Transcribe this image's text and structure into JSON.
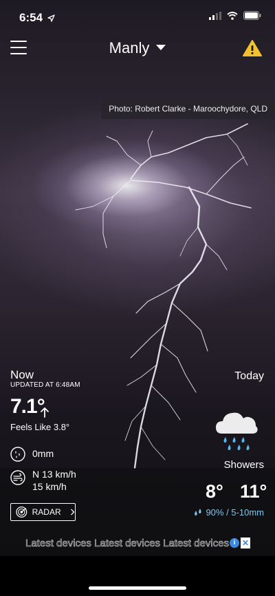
{
  "status_bar": {
    "time": "6:54"
  },
  "header": {
    "location": "Manly"
  },
  "photo_credit": "Photo: Robert Clarke - Maroochydore, QLD",
  "now": {
    "label": "Now",
    "updated": "UPDATED AT 6:48AM",
    "temperature": "7.1°",
    "feels_like": "Feels Like 3.8°",
    "rainfall": "0mm",
    "wind_direction_speed": "N 13 km/h",
    "wind_gust": "15 km/h"
  },
  "radar_button": {
    "label": "RADAR"
  },
  "today": {
    "label": "Today",
    "condition": "Showers",
    "min": "8°",
    "max": "11°",
    "rain_chance": "90% / 5-10mm"
  },
  "ad": {
    "text": "Latest devices Latest devices Latest devices"
  },
  "icons": [
    "menu-icon",
    "chevron-down-icon",
    "warning-icon",
    "arrow-up-icon",
    "rain-gauge-icon",
    "wind-icon",
    "radar-icon",
    "chevron-right-icon",
    "showers-icon",
    "raindrops-icon",
    "ad-info-icon",
    "close-icon"
  ],
  "colors": {
    "warning": "#f2c12e",
    "rain_accent": "#7fc7ef",
    "raindrop": "#57b6ee"
  }
}
